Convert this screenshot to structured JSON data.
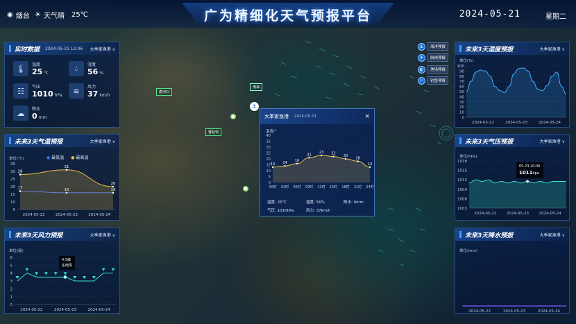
{
  "header": {
    "location": "烟台",
    "weather": "天气晴",
    "temperature": "25℃",
    "title": "广为精细化天气预报平台",
    "date": "2024-05-21",
    "weekday": "星期二"
  },
  "map": {
    "labels": [
      "唐河口",
      "渤海",
      "曹妃甸"
    ],
    "pin_icon": "anchor-icon",
    "quick_buttons": [
      "海洋预报",
      "航线预报",
      "渔场预报",
      "钓鱼预报"
    ]
  },
  "realtime": {
    "title": "实时数据",
    "timestamp": "2024-05-21 12:06",
    "selector": "大季家渔港",
    "items": [
      {
        "icon": "thermometer-icon",
        "label": "温度",
        "value": "25",
        "unit": "℃"
      },
      {
        "icon": "humidity-icon",
        "label": "湿度",
        "value": "56",
        "unit": "%"
      },
      {
        "icon": "pressure-icon",
        "label": "气压",
        "value": "1010",
        "unit": "hPa"
      },
      {
        "icon": "wind-icon",
        "label": "风力",
        "value": "37",
        "unit": "km/h"
      },
      {
        "icon": "rain-icon",
        "label": "降水",
        "value": "0",
        "unit": "mm"
      }
    ]
  },
  "temp_panel": {
    "title": "未来3天气温预报",
    "selector": "大季家渔港",
    "unit": "单位(℃)",
    "legend": [
      "最低温",
      "最高温"
    ]
  },
  "wind_panel": {
    "title": "未来3天风力预报",
    "selector": "大季家渔港",
    "unit": "单位(级)",
    "tooltip_level": "4-5级",
    "tooltip_dir": "东南风"
  },
  "humidity_panel": {
    "title": "未来3天湿度预报",
    "selector": "大季家渔港",
    "unit": "单位(%)"
  },
  "pressure_panel": {
    "title": "未来3天气压预报",
    "selector": "大季家渔港",
    "unit": "单位(hPa)",
    "tooltip_time": "05-23 20:36",
    "tooltip_value": "1011",
    "tooltip_unit": "hpa"
  },
  "rain_panel": {
    "title": "未来3天降水预报",
    "selector": "大季家渔港",
    "unit": "单位(mm)"
  },
  "popup": {
    "title": "大季家渔港",
    "date": "2024-05-21",
    "close": "×",
    "unit": "温度/°",
    "stats": {
      "temp": "温度: 25℃",
      "humidity": "湿度: 56%",
      "rain": "降水: 0mm",
      "pressure": "气压: 1010hPa",
      "wind": "风力: 37km/h"
    }
  },
  "chart_data": [
    {
      "id": "temp3d",
      "type": "line",
      "x": [
        "2024-05-22",
        "2024-05-23",
        "2024-05-24"
      ],
      "series": [
        {
          "name": "最低温",
          "values": [
            17,
            16,
            16
          ],
          "color": "#3a6dff"
        },
        {
          "name": "最高温",
          "values": [
            28,
            31,
            20
          ],
          "color": "#f0c040"
        }
      ],
      "y_ticks": [
        5,
        10,
        15,
        20,
        25,
        30,
        35
      ],
      "ylim": [
        5,
        35
      ]
    },
    {
      "id": "wind3d",
      "type": "line",
      "x": [
        "2024-05-22",
        "2024-05-23",
        "2024-05-24"
      ],
      "series": [
        {
          "values": [
            3,
            4,
            3.5,
            3.5,
            3.5,
            3.5,
            3,
            3,
            3,
            4,
            4
          ],
          "color": "#35e6c9"
        }
      ],
      "y_ticks": [
        0,
        1,
        2,
        3,
        4,
        5,
        6
      ],
      "ylim": [
        0,
        6
      ]
    },
    {
      "id": "humid3d",
      "type": "area",
      "x": [
        "2024-05-22",
        "2024-05-23",
        "2024-05-24"
      ],
      "series": [
        {
          "values": [
            50,
            70,
            88,
            92,
            90,
            80,
            60,
            52,
            48,
            60,
            85,
            95,
            96,
            90,
            70,
            55,
            52,
            62,
            80,
            88,
            60,
            45
          ],
          "color": "#3fb0ff"
        }
      ],
      "y_ticks": [
        0,
        10,
        20,
        30,
        40,
        50,
        60,
        70,
        80,
        90,
        100
      ],
      "ylim": [
        0,
        100
      ]
    },
    {
      "id": "press3d",
      "type": "area",
      "x": [
        "2024-05-22",
        "2024-05-23",
        "2024-05-24"
      ],
      "series": [
        {
          "values": [
            1011,
            1012,
            1011.5,
            1012,
            1011,
            1011.5,
            1011,
            1011.5,
            1011,
            1011.5,
            1011,
            1011.5,
            1011,
            1011.5,
            1011.5,
            1011.5
          ],
          "color": "#35e6c9"
        }
      ],
      "y_ticks": [
        1003,
        1006,
        1009,
        1012,
        1015,
        1018
      ],
      "ylim": [
        1003,
        1018
      ]
    },
    {
      "id": "rain3d",
      "type": "bar",
      "x": [
        "2024-05-22",
        "2024-05-23",
        "2024-05-24"
      ],
      "series": [
        {
          "values": [
            0,
            0,
            0
          ],
          "color": "#7a5cff"
        }
      ],
      "y_ticks": [],
      "ylim": [
        0,
        1
      ]
    },
    {
      "id": "popup24h",
      "type": "area",
      "categories": [
        "00时",
        "03时",
        "06时",
        "09时",
        "12时",
        "15时",
        "18时",
        "21时",
        "24时"
      ],
      "series": [
        {
          "values": [
            13,
            14,
            16,
            21,
            23,
            22,
            20,
            18,
            13
          ],
          "color": "#f0c040"
        }
      ],
      "y_ticks": [
        0,
        5,
        10,
        15,
        20,
        25,
        30,
        35,
        40
      ],
      "ylim": [
        0,
        40
      ]
    }
  ]
}
